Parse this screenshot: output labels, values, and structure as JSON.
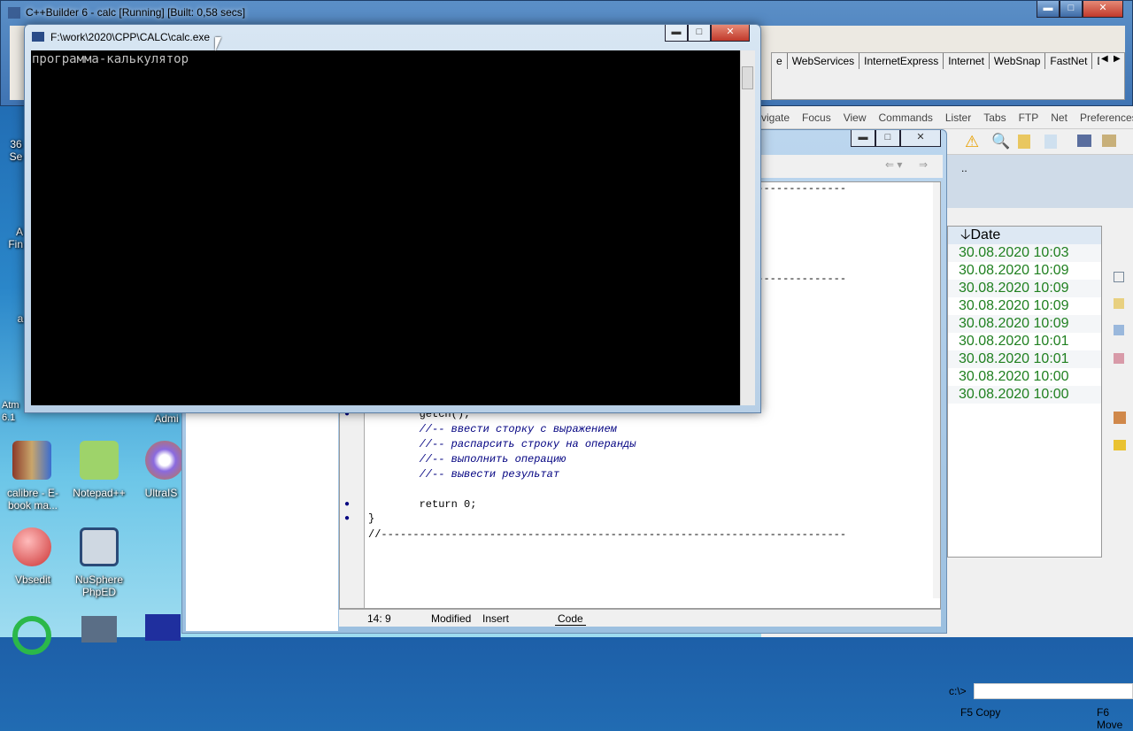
{
  "builder": {
    "title": "C++Builder 6 - calc [Running] [Built: 0,58 secs]",
    "palette_tabs": [
      "e",
      "WebServices",
      "InternetExpress",
      "Internet",
      "WebSnap",
      "FastNet",
      "Decision"
    ]
  },
  "desktop_icons": [
    {
      "label": "36\nSe"
    },
    {
      "label": "A\nFin"
    },
    {
      "label": "a"
    },
    {
      "label": "Atm\n6.1"
    },
    {
      "label": "Admi"
    },
    {
      "label": "calibre - E-book ma..."
    },
    {
      "label": "Notepad++"
    },
    {
      "label": "UltraIS"
    },
    {
      "label": "Vbsedit"
    },
    {
      "label": "NuSphere PhpED"
    }
  ],
  "console": {
    "title": "F:\\work\\2020\\CPP\\CALC\\calc.exe",
    "output": "программа-калькулятор"
  },
  "commander": {
    "menu": [
      "vigate",
      "Focus",
      "View",
      "Commands",
      "Lister",
      "Tabs",
      "FTP",
      "Net",
      "Preferences"
    ],
    "path": "..",
    "column_header": "Date",
    "dates": [
      "30.08.2020 10:03",
      "30.08.2020 10:09",
      "30.08.2020 10:09",
      "30.08.2020 10:09",
      "30.08.2020 10:09",
      "30.08.2020 10:01",
      "30.08.2020 10:01",
      "30.08.2020 10:00",
      "30.08.2020 10:00"
    ],
    "cmd_prompt": "c:\\>",
    "fkeys": [
      "F5 Copy",
      "F6 Move"
    ]
  },
  "editor": {
    "lines": [
      {
        "text": "//-------------------------------------------------------------------------",
        "cm": false,
        "dot": false
      },
      {
        "text": "//-------------------------------------------------------------------------",
        "cm": false,
        "dot": false
      },
      {
        "text": "        getch();",
        "cm": false,
        "dot": true
      },
      {
        "text": "        //-- ввести сторку с выражением",
        "cm": true,
        "dot": false
      },
      {
        "text": "        //-- распарсить строку на операнды",
        "cm": true,
        "dot": false
      },
      {
        "text": "        //-- выполнить операцию",
        "cm": true,
        "dot": false
      },
      {
        "text": "        //-- вывести результат",
        "cm": true,
        "dot": false
      },
      {
        "text": "",
        "cm": false,
        "dot": false
      },
      {
        "text": "        return 0;",
        "cm": false,
        "dot": true
      },
      {
        "text": "}",
        "cm": false,
        "dot": true
      },
      {
        "text": "//-------------------------------------------------------------------------",
        "cm": false,
        "dot": false
      }
    ],
    "status": {
      "position": "14:  9",
      "modified": "Modified",
      "mode": "Insert",
      "tab": "Code"
    }
  }
}
